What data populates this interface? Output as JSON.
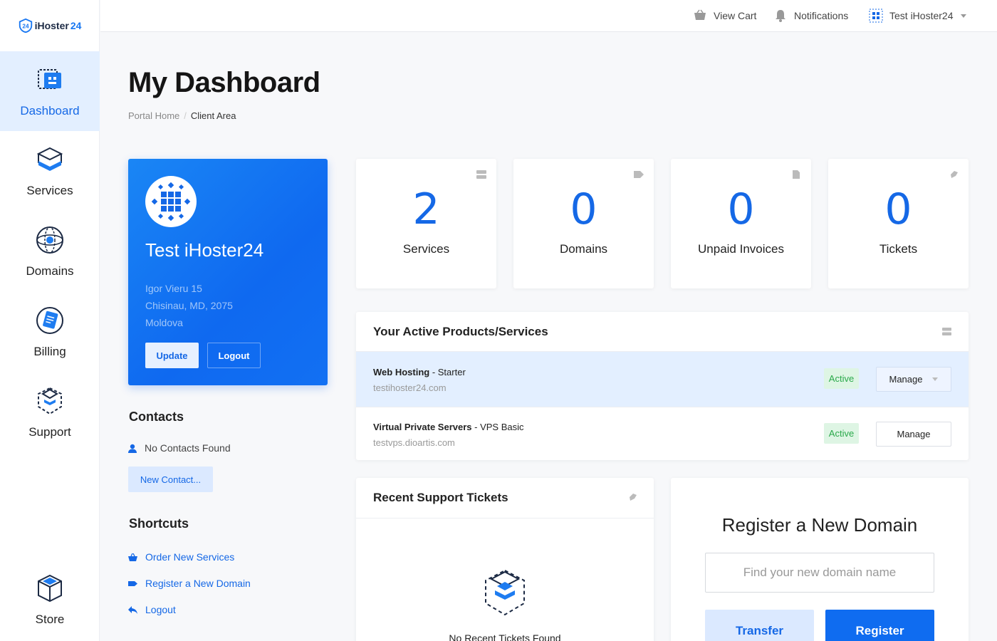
{
  "brand": {
    "name_prefix": "iHoster",
    "name_suffix": "24",
    "accent": "#1568e6"
  },
  "sidebar": {
    "items": [
      {
        "label": "Dashboard",
        "icon": "dashboard-icon",
        "active": true
      },
      {
        "label": "Services",
        "icon": "services-box-icon"
      },
      {
        "label": "Domains",
        "icon": "globe-icon"
      },
      {
        "label": "Billing",
        "icon": "billing-icon"
      },
      {
        "label": "Support",
        "icon": "support-box-icon"
      },
      {
        "label": "Store",
        "icon": "store-cube-icon"
      }
    ]
  },
  "topbar": {
    "view_cart": "View Cart",
    "notifications": "Notifications",
    "account": "Test iHoster24"
  },
  "page": {
    "title": "My Dashboard",
    "breadcrumb": [
      "Portal Home",
      "Client Area"
    ]
  },
  "profile": {
    "name": "Test iHoster24",
    "address1": "Igor Vieru 15",
    "address2": "Chisinau, MD, 2075",
    "country": "Moldova",
    "update_label": "Update",
    "logout_label": "Logout"
  },
  "contacts": {
    "heading": "Contacts",
    "empty": "No Contacts Found",
    "new_label": "New Contact..."
  },
  "shortcuts": {
    "heading": "Shortcuts",
    "items": [
      {
        "label": "Order New Services",
        "icon": "basket-icon"
      },
      {
        "label": "Register a New Domain",
        "icon": "tag-icon"
      },
      {
        "label": "Logout",
        "icon": "back-arrow-icon"
      }
    ]
  },
  "stats": [
    {
      "value": "2",
      "label": "Services",
      "icon": "server-icon"
    },
    {
      "value": "0",
      "label": "Domains",
      "icon": "tag-icon"
    },
    {
      "value": "0",
      "label": "Unpaid Invoices",
      "icon": "document-icon"
    },
    {
      "value": "0",
      "label": "Tickets",
      "icon": "comment-icon"
    }
  ],
  "products": {
    "heading": "Your Active Products/Services",
    "rows": [
      {
        "product": "Web Hosting",
        "plan": " - Starter",
        "domain": "testihoster24.com",
        "status": "Active",
        "action": "Manage"
      },
      {
        "product": "Virtual Private Servers",
        "plan": " - VPS Basic",
        "domain": "testvps.dioartis.com",
        "status": "Active",
        "action": "Manage"
      }
    ]
  },
  "tickets": {
    "heading": "Recent Support Tickets",
    "empty": "No Recent Tickets Found"
  },
  "domain": {
    "heading": "Register a New Domain",
    "placeholder": "Find your new domain name",
    "transfer_label": "Transfer",
    "register_label": "Register"
  }
}
